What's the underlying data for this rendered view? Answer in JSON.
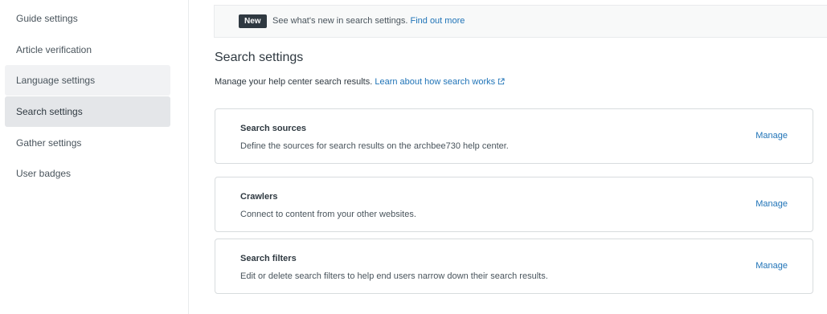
{
  "sidebar": {
    "items": [
      {
        "label": "Guide settings"
      },
      {
        "label": "Article verification"
      },
      {
        "label": "Language settings"
      },
      {
        "label": "Search settings"
      },
      {
        "label": "Gather settings"
      },
      {
        "label": "User badges"
      }
    ]
  },
  "banner": {
    "badge": "New",
    "text": "See what's new in search settings.",
    "link": "Find out more"
  },
  "page": {
    "title": "Search settings",
    "description": "Manage your help center search results.",
    "description_link": "Learn about how search works"
  },
  "cards": [
    {
      "title": "Search sources",
      "description": "Define the sources for search results on the archbee730 help center.",
      "action": "Manage"
    },
    {
      "title": "Crawlers",
      "description": "Connect to content from your other websites.",
      "action": "Manage"
    },
    {
      "title": "Search filters",
      "description": "Edit or delete search filters to help end users narrow down their search results.",
      "action": "Manage"
    }
  ],
  "colors": {
    "link": "#1f73b7",
    "badge_bg": "#2f3941",
    "active_nav_bg": "#e4e6e9"
  },
  "icons": {
    "external_link": "external-link-icon"
  }
}
